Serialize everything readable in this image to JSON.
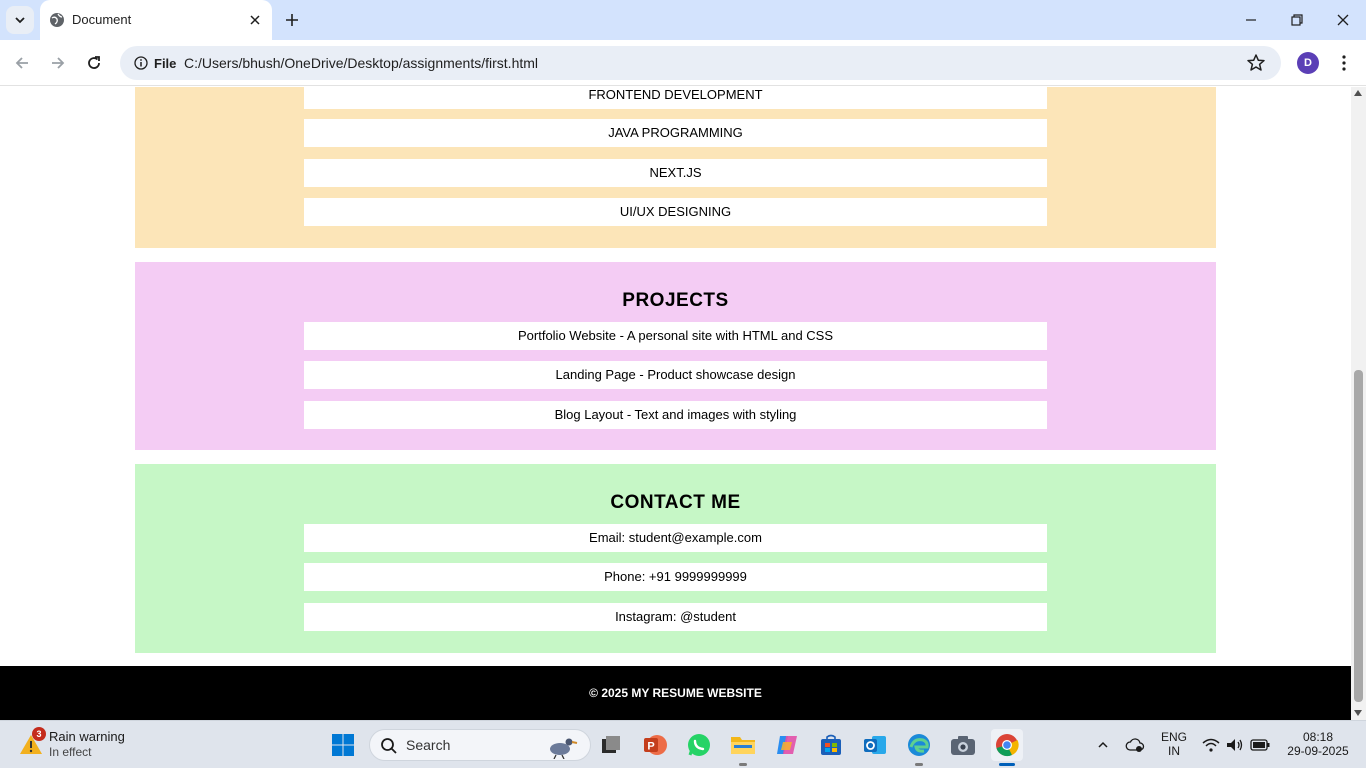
{
  "browser": {
    "tab_title": "Document",
    "site_chip_label": "File",
    "url": "C:/Users/bhush/OneDrive/Desktop/assignments/first.html",
    "profile_initial": "D"
  },
  "page": {
    "skills": {
      "items": [
        "FRONTEND DEVELOPMENT",
        "JAVA PROGRAMMING",
        "NEXT.JS",
        "UI/UX DESIGNING"
      ],
      "background": "#fce5b8"
    },
    "projects": {
      "heading": "PROJECTS",
      "items": [
        "Portfolio Website - A personal site with HTML and CSS",
        "Landing Page - Product showcase design",
        "Blog Layout - Text and images with styling"
      ],
      "background": "#f4ccf4"
    },
    "contact": {
      "heading": "CONTACT ME",
      "items": [
        "Email: student@example.com",
        "Phone: +91 9999999999",
        "Instagram: @student"
      ],
      "background": "#c6f7c6"
    },
    "footer": "© 2025 MY RESUME WEBSITE"
  },
  "taskbar": {
    "weather_title": "Rain warning",
    "weather_subtitle": "In effect",
    "weather_badge": "3",
    "search_label": "Search",
    "lang_top": "ENG",
    "lang_bottom": "IN",
    "time": "08:18",
    "date": "29-09-2025"
  }
}
